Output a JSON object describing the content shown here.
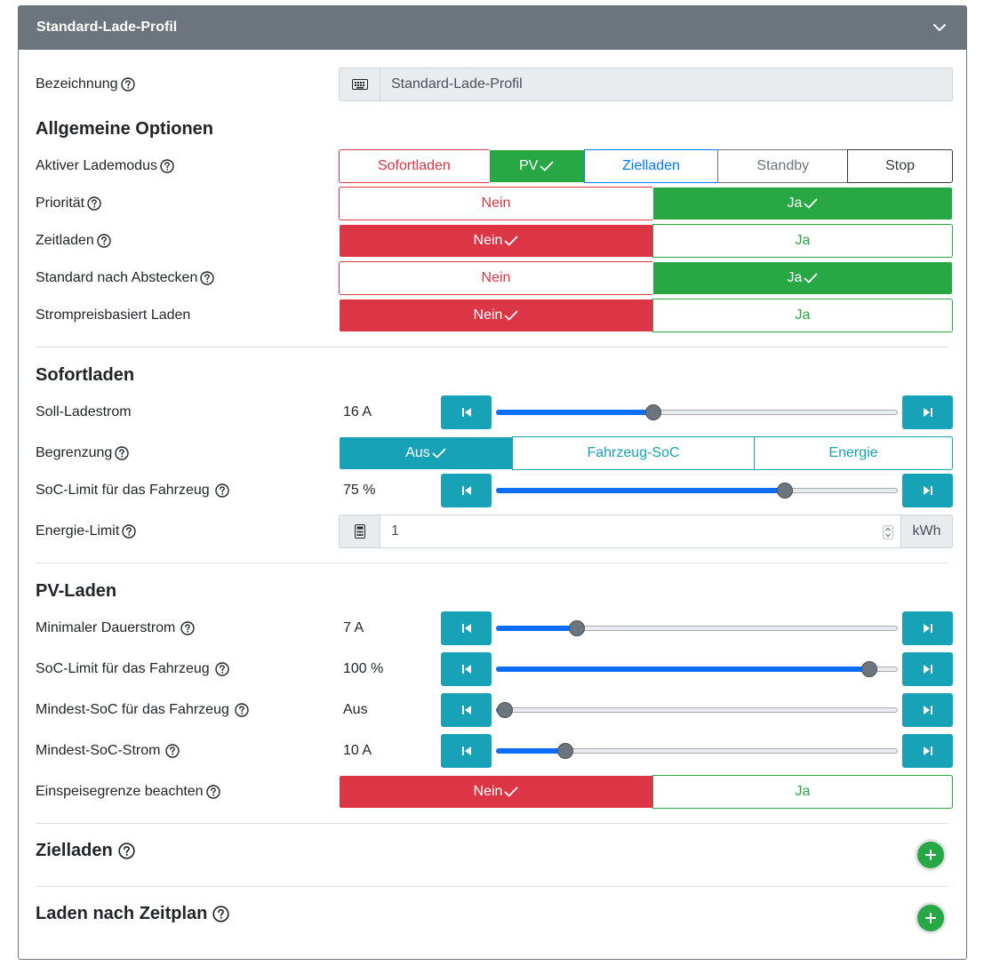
{
  "header": {
    "title": "Standard-Lade-Profil"
  },
  "name_field": {
    "label": "Bezeichnung",
    "value": "Standard-Lade-Profil"
  },
  "general": {
    "title": "Allgemeine Optionen",
    "mode": {
      "label": "Aktiver Lademodus",
      "options": [
        "Sofortladen",
        "PV",
        "Zielladen",
        "Standby",
        "Stop"
      ],
      "selected": "PV"
    },
    "priority": {
      "label": "Priorität",
      "no": "Nein",
      "yes": "Ja",
      "selected": "Ja"
    },
    "time_charging": {
      "label": "Zeitladen",
      "no": "Nein",
      "yes": "Ja",
      "selected": "Nein"
    },
    "default_after_unplug": {
      "label": "Standard nach Abstecken",
      "no": "Nein",
      "yes": "Ja",
      "selected": "Ja"
    },
    "price_based": {
      "label": "Strompreisbasiert Laden",
      "no": "Nein",
      "yes": "Ja",
      "selected": "Nein"
    }
  },
  "instant": {
    "title": "Sofortladen",
    "current": {
      "label": "Soll-Ladestrom",
      "value": "16 A",
      "fraction": 0.39
    },
    "limit": {
      "label": "Begrenzung",
      "options": [
        "Aus",
        "Fahrzeug-SoC",
        "Energie"
      ],
      "selected": "Aus"
    },
    "soc_limit": {
      "label": "SoC-Limit für das Fahrzeug",
      "value": "75 %",
      "fraction": 0.72
    },
    "energy_limit": {
      "label": "Energie-Limit",
      "value": "1",
      "unit": "kWh"
    }
  },
  "pv": {
    "title": "PV-Laden",
    "min_current": {
      "label": "Minimaler Dauerstrom",
      "value": "7 A",
      "fraction": 0.2
    },
    "soc_limit": {
      "label": "SoC-Limit für das Fahrzeug",
      "value": "100 %",
      "fraction": 0.93
    },
    "min_soc": {
      "label": "Mindest-SoC für das Fahrzeug",
      "value": "Aus",
      "fraction": 0.02
    },
    "min_soc_current": {
      "label": "Mindest-SoC-Strom",
      "value": "10 A",
      "fraction": 0.17
    },
    "feed_in_limit": {
      "label": "Einspeisegrenze beachten",
      "no": "Nein",
      "yes": "Ja",
      "selected": "Nein"
    }
  },
  "target": {
    "title": "Zielladen"
  },
  "schedule": {
    "title": "Laden nach Zeitplan"
  },
  "colors": {
    "header": "#6c757d",
    "danger": "#dc3545",
    "success": "#28a745",
    "info": "#17a2b8",
    "primary": "#007bff",
    "slider_fill": "#0d6efd"
  },
  "icons": [
    "chevron-down-icon",
    "help-icon",
    "keyboard-icon",
    "calculator-icon",
    "skip-start-icon",
    "skip-end-icon",
    "check-icon",
    "plus-icon"
  ]
}
